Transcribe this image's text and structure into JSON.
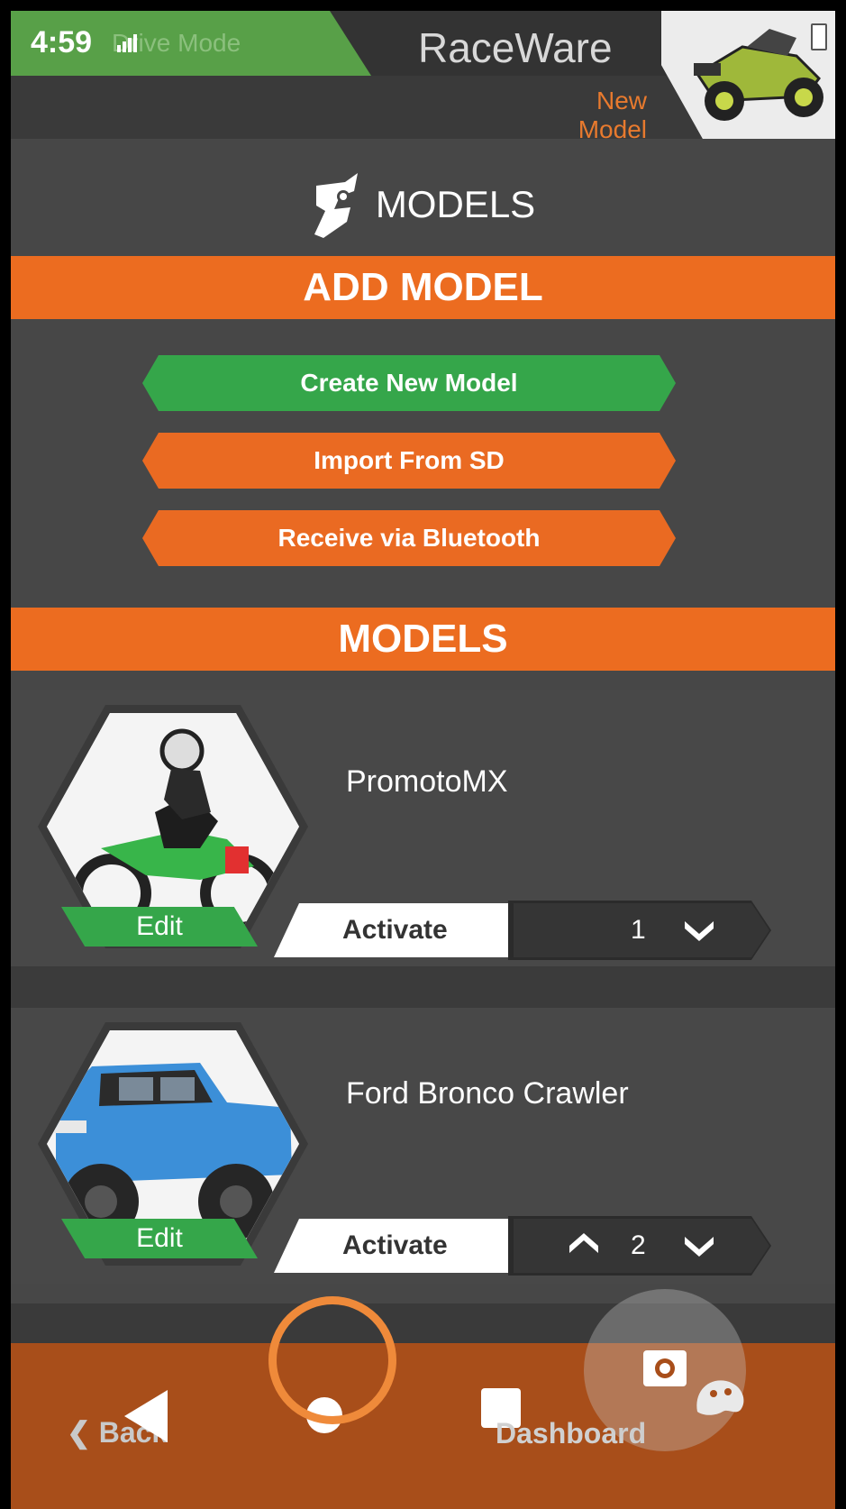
{
  "status_bar": {
    "time": "4:59",
    "mode_label": "Drive Mode"
  },
  "header": {
    "app_title": "RaceWare",
    "current_model": "New Model"
  },
  "page": {
    "title": "MODELS"
  },
  "add_model_section": {
    "heading": "ADD MODEL",
    "actions": [
      {
        "label": "Create New Model",
        "color": "#35a64a"
      },
      {
        "label": "Import From SD",
        "color": "#ea6a22"
      },
      {
        "label": "Receive via Bluetooth",
        "color": "#ea6a22"
      }
    ]
  },
  "models_section": {
    "heading": "MODELS",
    "models": [
      {
        "name": "PromotoMX",
        "edit_label": "Edit",
        "activate_label": "Activate",
        "index": "1",
        "image": "motorcycle-photo"
      },
      {
        "name": "Ford Bronco Crawler",
        "edit_label": "Edit",
        "activate_label": "Activate",
        "index": "2",
        "image": "blue-truck-photo"
      }
    ]
  },
  "bottom_nav": {
    "back_label": "Back",
    "dashboard_label": "Dashboard"
  },
  "colors": {
    "accent_orange": "#ec6c20",
    "accent_green": "#35a64a",
    "nav_brown": "#a84e1a",
    "highlight_ring": "#ef8a3a"
  }
}
